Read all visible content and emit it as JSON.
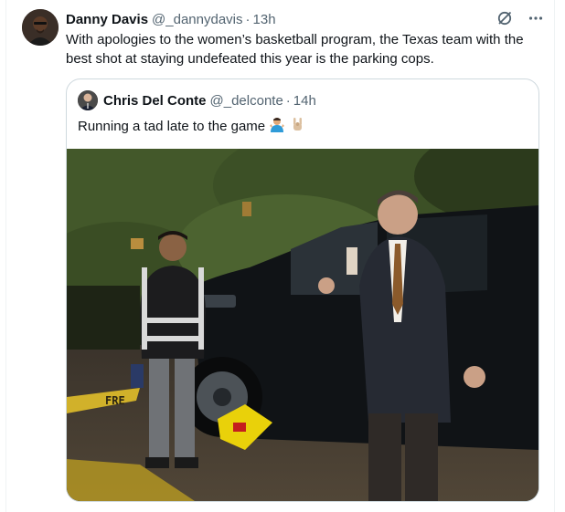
{
  "tweet": {
    "author_name": "Danny Davis",
    "author_handle": "@_dannydavis",
    "separator": "·",
    "time": "13h",
    "text": "With apologies to the women’s basketball program, the Texas team with the best shot at staying undefeated this year is the parking cops.",
    "icons": {
      "grok": "grok-icon",
      "more": "more-icon"
    }
  },
  "quote": {
    "author_name": "Chris Del Conte",
    "author_handle": "@_delconte",
    "separator": "·",
    "time": "14h",
    "text": "Running a tad late to the game",
    "emojis": [
      "person-shrugging-emoji",
      "rock-on-hand-emoji"
    ],
    "photo": {
      "curb_text": "FRE"
    }
  },
  "colors": {
    "text": "#0f1419",
    "secondary": "#536471",
    "border": "#cfd9de",
    "vest": "#1c1c1e",
    "reflective": "#d9d9d9",
    "boot": "#e9d10a"
  }
}
